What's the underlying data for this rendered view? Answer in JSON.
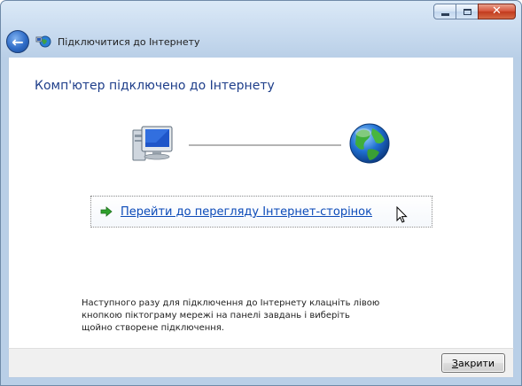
{
  "window": {
    "title": "Підключитися до Інтернету",
    "caption": {
      "minimize_icon": "minimize-icon",
      "maximize_icon": "maximize-icon",
      "close_icon": "close-icon"
    }
  },
  "main": {
    "heading": "Комп'ютер підключено до Інтернету",
    "link_label": "Перейти до перегляду Інтернет-сторінок",
    "info_text_line1": "Наступного разу для підключення до Інтернету клацніть лівою",
    "info_text_line2": "кнопкою піктограму мережі на панелі завдань і виберіть",
    "info_text_line3": "щойно створене підключення.",
    "icons": [
      "computer-icon",
      "globe-icon",
      "green-arrow-icon"
    ]
  },
  "footer": {
    "close_accel": "З",
    "close_rest": "акрити"
  },
  "colors": {
    "heading": "#1e3e8a",
    "link": "#0b4ab8",
    "close_button": "#c23a1e"
  }
}
